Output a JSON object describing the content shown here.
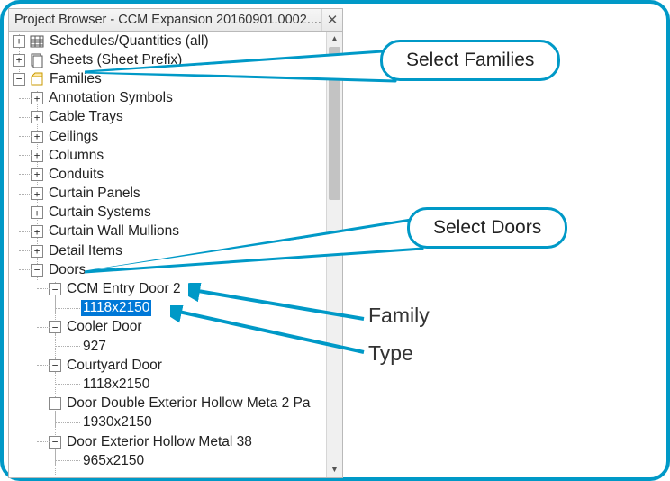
{
  "window": {
    "title": "Project Browser - CCM Expansion 20160901.0002....",
    "close_glyph": "✕"
  },
  "tree": {
    "schedules": "Schedules/Quantities (all)",
    "sheets": "Sheets (Sheet Prefix)",
    "families": "Families",
    "items": {
      "annotation": "Annotation Symbols",
      "cable_trays": "Cable Trays",
      "ceilings": "Ceilings",
      "columns": "Columns",
      "conduits": "Conduits",
      "curt_panels": "Curtain Panels",
      "curt_systems": "Curtain Systems",
      "curt_mullions": "Curtain Wall Mullions",
      "detail_items": "Detail Items",
      "doors": "Doors",
      "ccm_entry": "CCM Entry Door 2",
      "ccm_entry_type": "1118x2150",
      "cooler_door": "Cooler Door",
      "cooler_type": "927",
      "courtyard": "Courtyard Door",
      "courtyard_type": "1118x2150",
      "dbl_ext": "Door Double Exterior Hollow Meta 2 Pa",
      "dbl_ext_type": "1930x2150",
      "ext_hollow": "Door Exterior Hollow Metal 38",
      "ext_hollow_type": "965x2150"
    }
  },
  "callouts": {
    "families": "Select Families",
    "doors": "Select Doors"
  },
  "anno": {
    "family": "Family",
    "type": "Type"
  },
  "scroll": {
    "up": "▲",
    "down": "▼"
  }
}
